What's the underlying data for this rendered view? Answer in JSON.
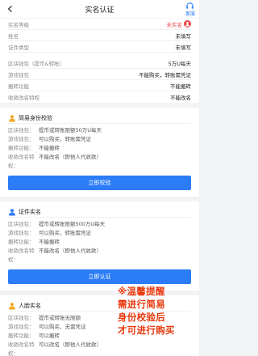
{
  "header": {
    "title": "实名认证",
    "service_label": "客服"
  },
  "info": [
    {
      "key": "实名等级",
      "value": "未实名",
      "status": "red"
    },
    {
      "key": "姓名",
      "value": "未填写"
    },
    {
      "key": "证件类型",
      "value": "未填写"
    }
  ],
  "limits": [
    {
      "key": "区块钱包（提币&转账）",
      "value": "5万U每天"
    },
    {
      "key": "游戏钱包",
      "value": "不能购买，转账需凭证"
    },
    {
      "key": "搬砖功能",
      "value": "不能搬砖"
    },
    {
      "key": "收款改名特权",
      "value": "不能改名"
    }
  ],
  "cards": [
    {
      "title": "简易身份校验",
      "rows": [
        {
          "key": "区块钱包：",
          "value": "提币或转账限额50万U每天"
        },
        {
          "key": "游戏钱包：",
          "value": "可以购买，转账需凭证"
        },
        {
          "key": "搬砖功能：",
          "value": "不能搬砖"
        },
        {
          "key": "收款改名特权：",
          "value": "不能改名（即他人代收款）"
        }
      ],
      "button": "立即校验"
    },
    {
      "title": "证件实名",
      "rows": [
        {
          "key": "区块钱包：",
          "value": "提币或转账限额500万U每天"
        },
        {
          "key": "游戏钱包：",
          "value": "可以购买，转账需凭证"
        },
        {
          "key": "搬砖功能：",
          "value": "不能搬砖"
        },
        {
          "key": "收款改名特权：",
          "value": "不能改名（即他人代收款）"
        }
      ],
      "button": "立即认证"
    },
    {
      "title": "人脸实名",
      "rows": [
        {
          "key": "区块钱包：",
          "value": "提币或转账无限额"
        },
        {
          "key": "游戏钱包：",
          "value": "可以购买，无需凭证"
        },
        {
          "key": "搬砖功能：",
          "value": "可以搬砖"
        },
        {
          "key": "收款改名特权：",
          "value": "可以改名（即他人代收款）"
        }
      ]
    }
  ],
  "tip": {
    "lines": [
      "※温馨提醒",
      "需进行简易",
      "身份校验后",
      "才可进行购买"
    ]
  },
  "colors": {
    "accent": "#2b7cf6",
    "warning": "#e94545",
    "tip": "#e8380d"
  }
}
